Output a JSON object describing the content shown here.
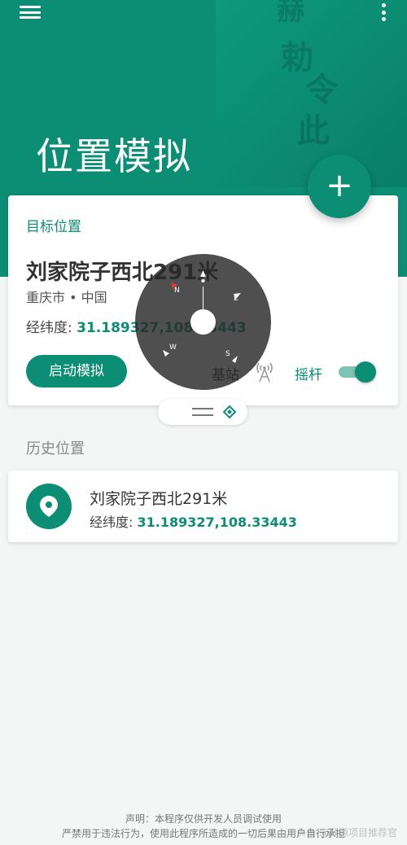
{
  "header": {
    "title": "位置模拟",
    "background_color": "#0b8e74",
    "menu_icon": "hamburger-menu-icon",
    "more_icon": "more-vert-icon",
    "fab_label": "+"
  },
  "target": {
    "section_label": "目标位置",
    "place_name": "刘家院子西北291米",
    "region": "重庆市 • 中国",
    "coord_label": "经纬度:",
    "coord_value": "31.189327,108.33443",
    "start_button": "启动模拟",
    "base_station_label": "基站",
    "joystick_label": "摇杆",
    "joystick_enabled": true
  },
  "joystick_overlay": {
    "directions": [
      "N",
      "E",
      "S",
      "W"
    ]
  },
  "history": {
    "section_title": "历史位置",
    "items": [
      {
        "name": "刘家院子西北291米",
        "coord_label": "经纬度:",
        "coord_value": "31.189327,108.33443"
      }
    ]
  },
  "footer": {
    "line1": "声明：本程序仅供开发人员调试使用",
    "line2": "严禁用于违法行为，使用此程序所造成的一切后果由用户自行承担"
  },
  "watermark": "头条 @开源项目推荐官",
  "colors": {
    "accent": "#0b8e74",
    "background": "#f4f5f5"
  }
}
